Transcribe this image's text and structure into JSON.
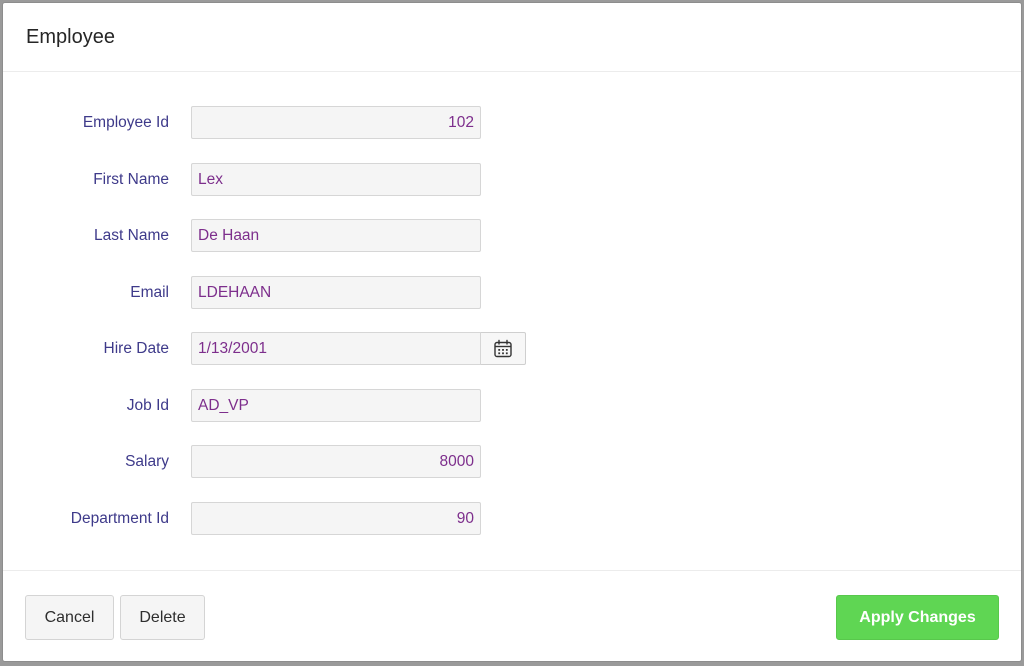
{
  "dialog": {
    "title": "Employee"
  },
  "form": {
    "employee_id": {
      "label": "Employee Id",
      "value": "102"
    },
    "first_name": {
      "label": "First Name",
      "value": "Lex"
    },
    "last_name": {
      "label": "Last Name",
      "value": "De Haan"
    },
    "email": {
      "label": "Email",
      "value": "LDEHAAN"
    },
    "hire_date": {
      "label": "Hire Date",
      "value": "1/13/2001",
      "picker_icon": "calendar-icon"
    },
    "job_id": {
      "label": "Job Id",
      "value": "AD_VP"
    },
    "salary": {
      "label": "Salary",
      "value": "8000"
    },
    "department_id": {
      "label": "Department Id",
      "value": "90"
    }
  },
  "footer": {
    "cancel_label": "Cancel",
    "delete_label": "Delete",
    "apply_label": "Apply Changes"
  },
  "colors": {
    "label": "#3e3a8a",
    "value": "#7d2e8c",
    "apply_button": "#5fd653"
  }
}
